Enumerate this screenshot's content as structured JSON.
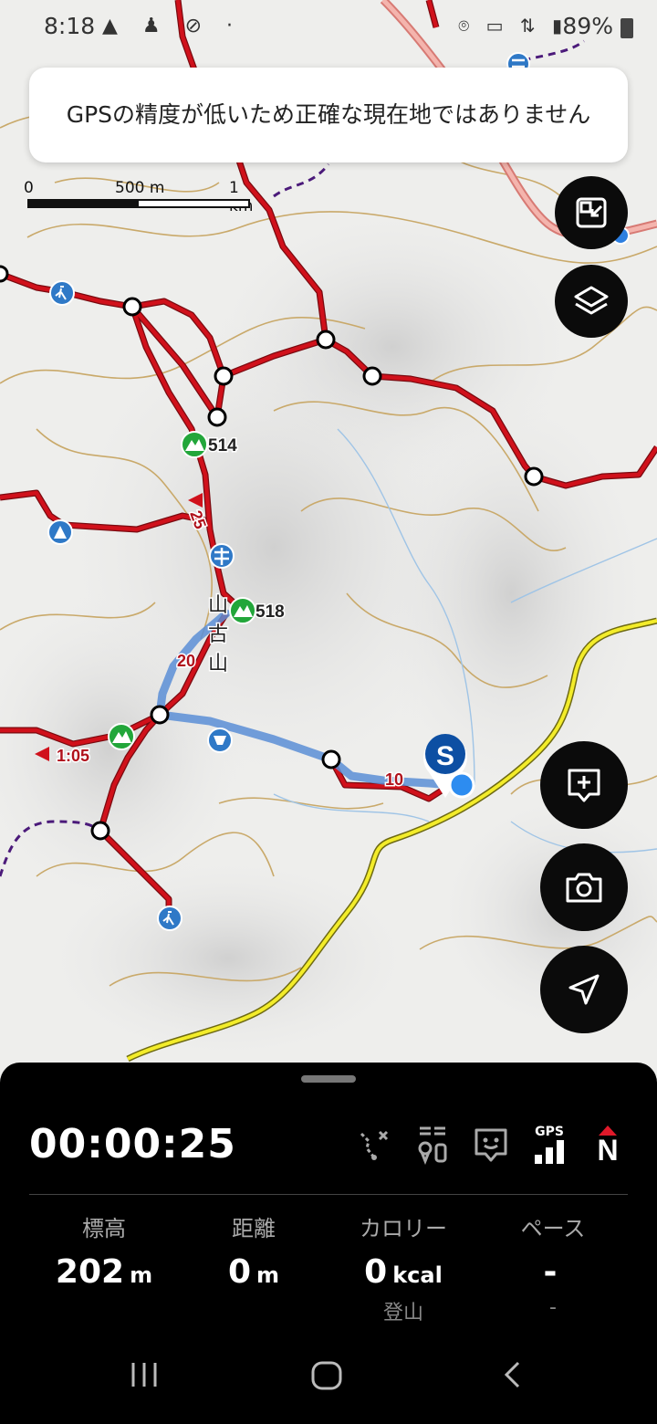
{
  "status_bar": {
    "time": "8:18",
    "battery": "89%"
  },
  "toast": {
    "message": "GPSの精度が低いため正確な現在地ではありません"
  },
  "scale_bar": {
    "zero": "0",
    "mid": "500 m",
    "max": "1 km"
  },
  "map": {
    "peaks": [
      {
        "label": "514"
      },
      {
        "label": "518"
      }
    ],
    "course_times": [
      "25",
      "20",
      "1:05",
      "10"
    ],
    "mountain_name": [
      "山",
      "古",
      "山"
    ],
    "start_marker": "S"
  },
  "buttons": {
    "fullscreen": "fullscreen-exit-icon",
    "layers": "layers-icon",
    "add_note": "add-note-icon",
    "camera": "camera-icon",
    "locate": "navigation-icon"
  },
  "panel": {
    "timer": "00:00:25",
    "sensors": {
      "gps_label": "GPS",
      "compass_label": "N"
    },
    "stats": [
      {
        "label": "標高",
        "value": "202",
        "unit": "m",
        "sub": ""
      },
      {
        "label": "距離",
        "value": "0",
        "unit": "m",
        "sub": ""
      },
      {
        "label": "カロリー",
        "value": "0",
        "unit": "kcal",
        "sub": "登山"
      },
      {
        "label": "ペース",
        "value": "-",
        "unit": "",
        "sub": "-"
      }
    ]
  },
  "colors": {
    "trail": "#d0111b",
    "route": "#5b8ed6",
    "road": "#f3ec2a",
    "contour": "#c9a96a",
    "peak": "#22a63a",
    "poi": "#2f79c7"
  }
}
